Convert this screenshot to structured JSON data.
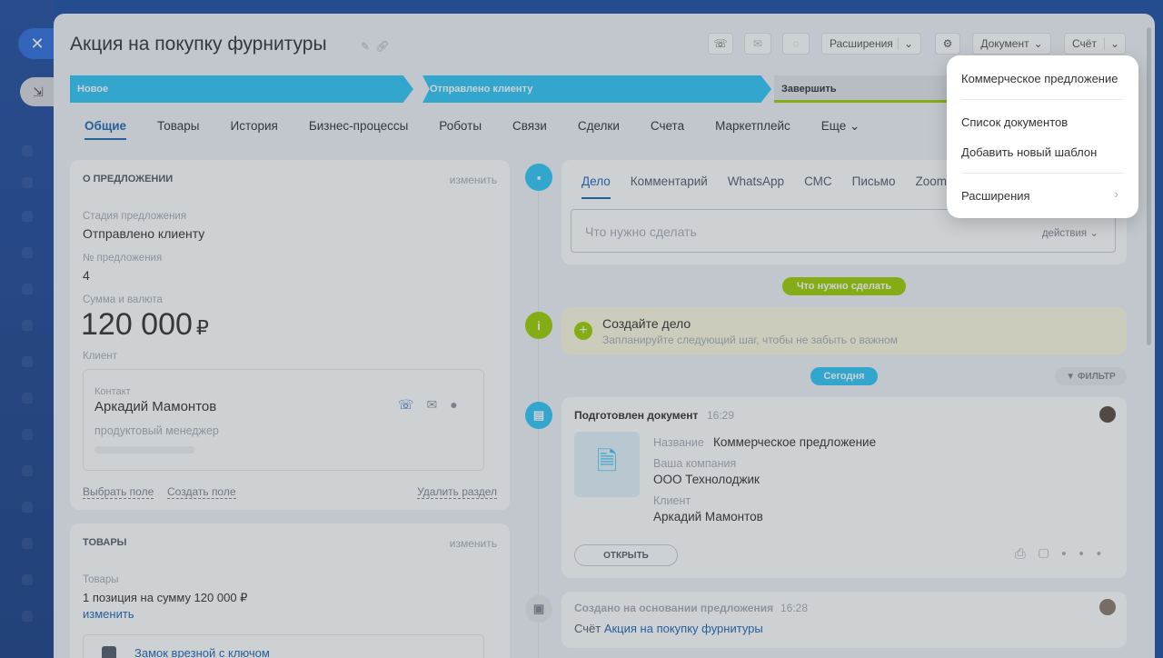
{
  "header": {
    "title": "Акция на покупку фурнитуры",
    "extensions_label": "Расширения",
    "document_label": "Документ",
    "invoice_label": "Счёт"
  },
  "pipeline": {
    "stages": [
      "Новое",
      "Отправлено клиенту",
      "Завершить"
    ]
  },
  "tabs": [
    "Общие",
    "Товары",
    "История",
    "Бизнес-процессы",
    "Роботы",
    "Связи",
    "Сделки",
    "Счета",
    "Маркетплейс",
    "Еще"
  ],
  "about": {
    "heading": "О ПРЕДЛОЖЕНИИ",
    "edit": "изменить",
    "stage_label": "Стадия предложения",
    "stage_value": "Отправлено клиенту",
    "number_label": "№ предложения",
    "number_value": "4",
    "amount_label": "Сумма и валюта",
    "amount_value": "120 000",
    "currency": "₽",
    "client_label": "Клиент",
    "contact_label": "Контакт",
    "contact_name": "Аркадий Мамонтов",
    "contact_role": "продуктовый менеджер",
    "select_field": "Выбрать поле",
    "create_field": "Создать поле",
    "delete_section": "Удалить раздел"
  },
  "goods": {
    "heading": "ТОВАРЫ",
    "edit": "изменить",
    "label": "Товары",
    "summary": "1 позиция на сумму 120 000 ₽",
    "change": "изменить",
    "item": "Замок врезной с ключом"
  },
  "editor": {
    "tabs": [
      "Дело",
      "Комментарий",
      "WhatsApp",
      "СМС",
      "Письмо",
      "Zoom"
    ],
    "placeholder": "Что нужно сделать",
    "actions": "действия"
  },
  "timeline": {
    "todo_pill": "Что нужно сделать",
    "create_title": "Создайте дело",
    "create_sub": "Запланируйте следующий шаг, чтобы не забыть о важном",
    "today_pill": "Сегодня",
    "filter": "ФИЛЬТР",
    "doc_title": "Подготовлен документ",
    "doc_time": "16:29",
    "name_label": "Название",
    "name_value": "Коммерческое предложение",
    "company_label": "Ваша компания",
    "company_value": "ООО Технолоджик",
    "client_label": "Клиент",
    "client_value": "Аркадий Мамонтов",
    "open_button": "ОТКРЫТЬ",
    "created_title": "Создано на основании предложения",
    "created_time": "16:28",
    "invoice_prefix": "Счёт",
    "invoice_link": "Акция на покупку фурнитуры"
  },
  "dropdown": {
    "items": [
      "Коммерческое предложение",
      "Список документов",
      "Добавить новый шаблон",
      "Расширения"
    ]
  },
  "colors": {
    "accent": "#2fc6f6",
    "link": "#2067b0",
    "success": "#9dcf00"
  }
}
